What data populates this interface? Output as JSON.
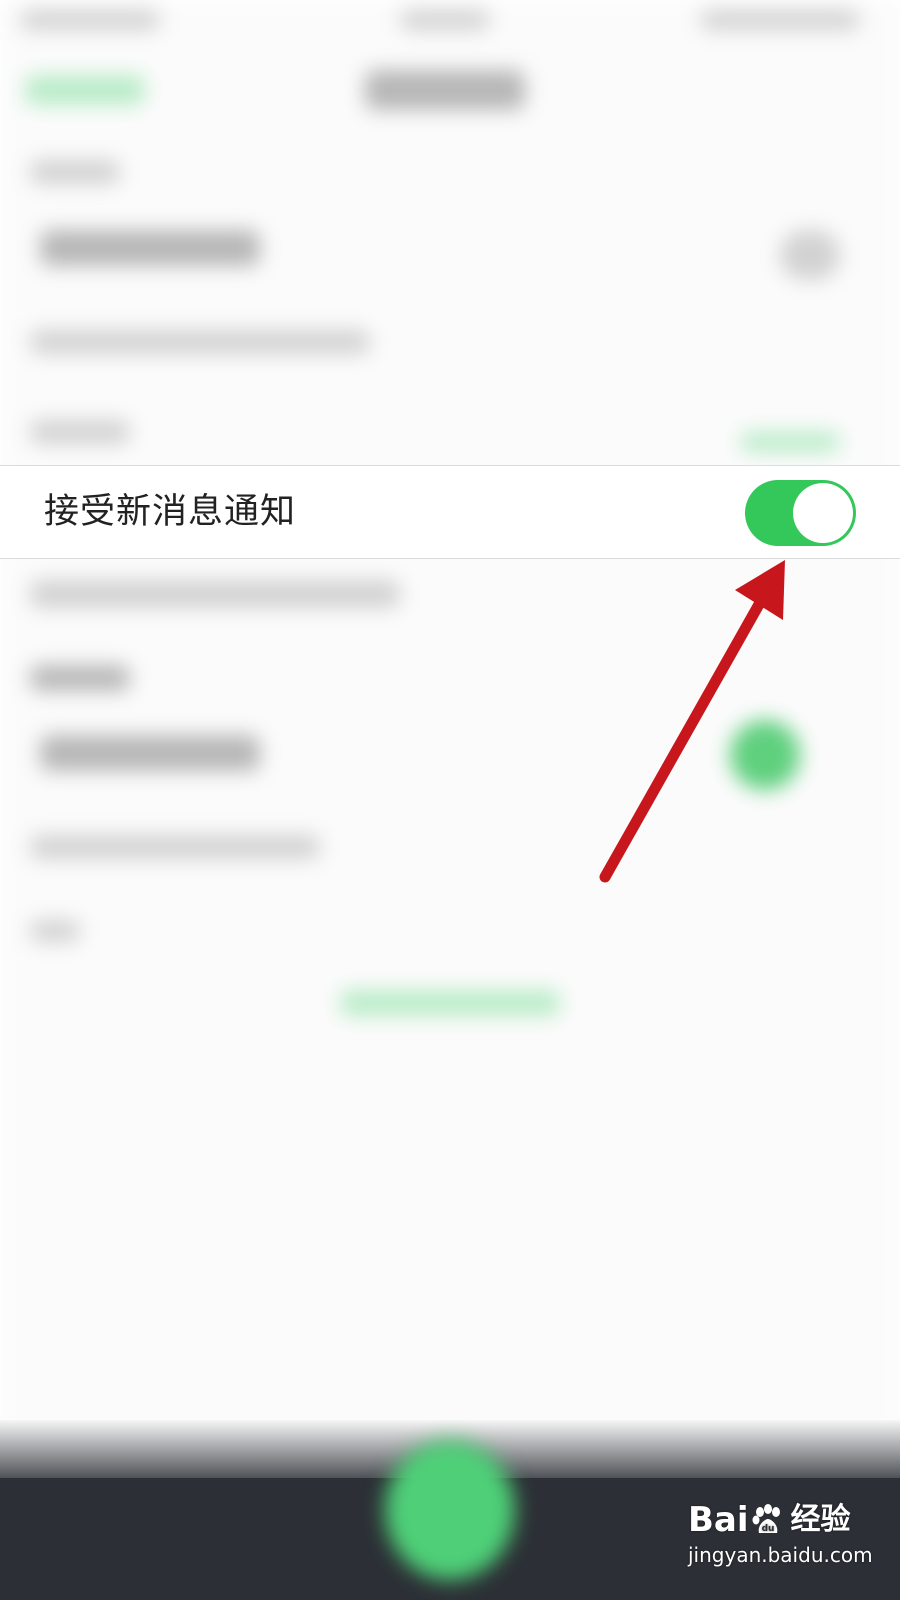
{
  "notification_row": {
    "label": "接受新消息通知",
    "toggle_on": true,
    "toggle_color": "#34c759"
  },
  "annotation": {
    "arrow_color": "#c8161d",
    "points_to": "toggle"
  },
  "watermark": {
    "brand_prefix": "Bai",
    "brand_suffix": "经验",
    "url": "jingyan.baidu.com",
    "logo_icon": "baidu-paw-icon"
  }
}
